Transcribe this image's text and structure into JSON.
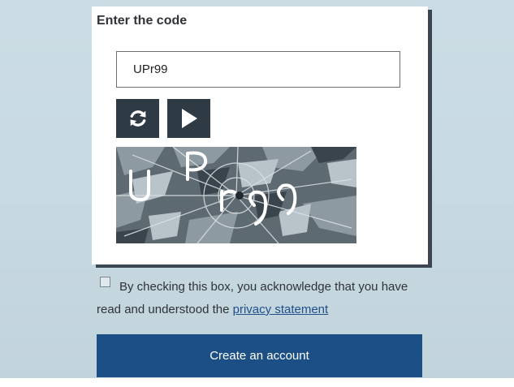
{
  "captcha": {
    "title": "Enter the code",
    "input_value": "UPr99",
    "refresh_icon": "refresh-icon",
    "play_icon": "play-audio-icon",
    "image_text": "UPr99"
  },
  "consent": {
    "text": "By checking this box, you acknowledge that you have read and understood the ",
    "link_label": "privacy statement",
    "checked": false
  },
  "actions": {
    "create_account_label": "Create an account"
  },
  "colors": {
    "background": "#c8dae2",
    "icon_button": "#2e3a44",
    "primary_button": "#1b4f86",
    "link": "#1e4f8c"
  }
}
